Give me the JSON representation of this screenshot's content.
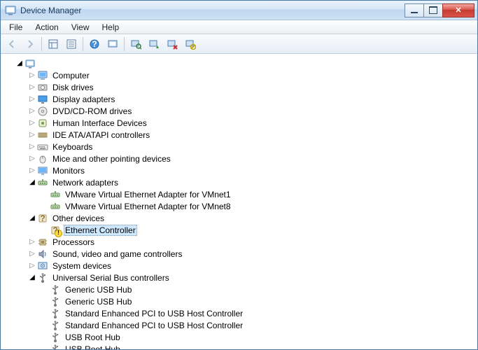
{
  "window": {
    "title": "Device Manager"
  },
  "menu": {
    "file": "File",
    "action": "Action",
    "view": "View",
    "help": "Help"
  },
  "toolbar_icons": {
    "back": "back-arrow-icon",
    "forward": "forward-arrow-icon",
    "show_hidden": "show-hidden-icon",
    "properties": "properties-icon",
    "help": "help-icon",
    "refresh": "refresh-icon",
    "scan": "scan-hardware-icon",
    "update": "update-driver-icon",
    "uninstall": "uninstall-icon",
    "disable": "disable-icon"
  },
  "tree": {
    "root_label": "",
    "nodes": [
      {
        "label": "Computer",
        "icon": "computer"
      },
      {
        "label": "Disk drives",
        "icon": "disk"
      },
      {
        "label": "Display adapters",
        "icon": "display"
      },
      {
        "label": "DVD/CD-ROM drives",
        "icon": "optical"
      },
      {
        "label": "Human Interface Devices",
        "icon": "hid"
      },
      {
        "label": "IDE ATA/ATAPI controllers",
        "icon": "ide"
      },
      {
        "label": "Keyboards",
        "icon": "keyboard"
      },
      {
        "label": "Mice and other pointing devices",
        "icon": "mouse"
      },
      {
        "label": "Monitors",
        "icon": "monitor"
      },
      {
        "label": "Network adapters",
        "icon": "network",
        "expanded": true,
        "children": [
          {
            "label": "VMware Virtual Ethernet Adapter for VMnet1",
            "icon": "network"
          },
          {
            "label": "VMware Virtual Ethernet Adapter for VMnet8",
            "icon": "network"
          }
        ]
      },
      {
        "label": "Other devices",
        "icon": "other",
        "expanded": true,
        "children": [
          {
            "label": "Ethernet Controller",
            "icon": "unknown",
            "warn": true,
            "selected": true
          }
        ]
      },
      {
        "label": "Processors",
        "icon": "cpu"
      },
      {
        "label": "Sound, video and game controllers",
        "icon": "sound"
      },
      {
        "label": "System devices",
        "icon": "system"
      },
      {
        "label": "Universal Serial Bus controllers",
        "icon": "usb",
        "expanded": true,
        "children": [
          {
            "label": "Generic USB Hub",
            "icon": "usb"
          },
          {
            "label": "Generic USB Hub",
            "icon": "usb"
          },
          {
            "label": "Standard Enhanced PCI to USB Host Controller",
            "icon": "usb"
          },
          {
            "label": "Standard Enhanced PCI to USB Host Controller",
            "icon": "usb"
          },
          {
            "label": "USB Root Hub",
            "icon": "usb"
          },
          {
            "label": "USB Root Hub",
            "icon": "usb"
          }
        ]
      }
    ]
  }
}
